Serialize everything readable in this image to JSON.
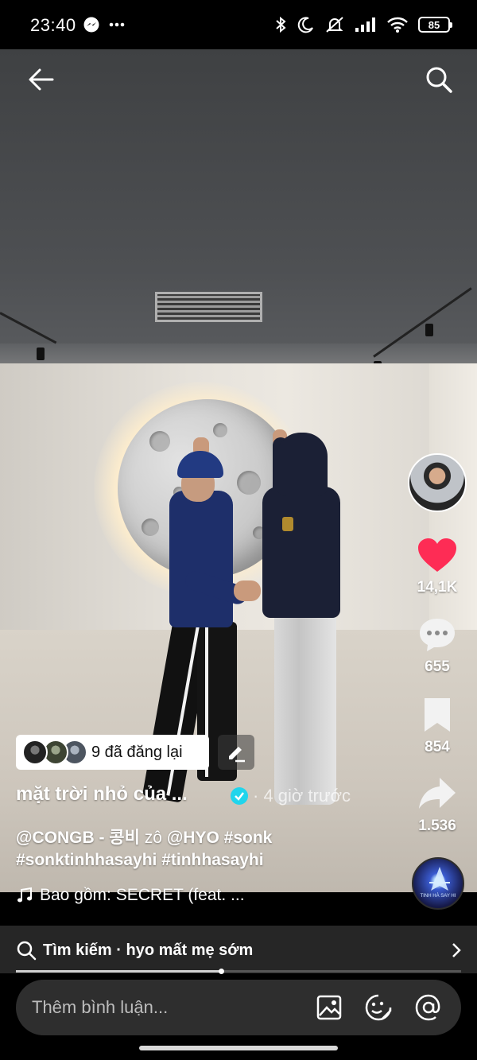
{
  "status_bar": {
    "time": "23:40",
    "left_icons": [
      "messenger-icon",
      "more-dots-icon"
    ],
    "right_icons": [
      "bluetooth-icon",
      "moon-icon",
      "mute-bell-icon",
      "signal-icon",
      "wifi-icon"
    ],
    "battery": "85"
  },
  "top_bar": {
    "back_icon": "arrow-left-icon",
    "search_icon": "search-icon"
  },
  "sidebar": {
    "likes": "14,1K",
    "comments": "655",
    "saves": "854",
    "shares": "1.536",
    "like_color": "#fe2c55"
  },
  "repost": {
    "label": "9 đã đăng lại"
  },
  "caption": {
    "title": "mặt trời nhỏ của ...",
    "time_ago": "· 4 giờ trước",
    "line1_creator": "@CONGB - 콩비",
    "line1_connector": "zô",
    "line1_mention": "@HYO",
    "line1_tag": "#sonk",
    "line2": "#sonktinhhasayhi #tinhhasayhi",
    "music": "Bao gồm: SECRET (feat. ..."
  },
  "music_disc": {
    "label": "TINH HÀ SAY HI"
  },
  "search_suggestion": {
    "prefix": "Tìm kiếm",
    "query": "hyo mất mẹ sớm",
    "text": "Tìm kiếm · hyo mất mẹ sớm"
  },
  "playback": {
    "progress": 0.46
  },
  "comment_bar": {
    "placeholder": "Thêm bình luận..."
  }
}
